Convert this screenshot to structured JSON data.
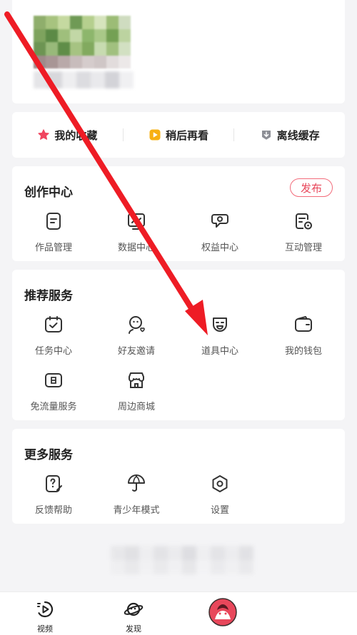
{
  "quick_actions": [
    {
      "label": "我的收藏",
      "icon": "star-icon"
    },
    {
      "label": "稍后再看",
      "icon": "play-later-icon"
    },
    {
      "label": "离线缓存",
      "icon": "download-icon"
    }
  ],
  "creation_center": {
    "title": "创作中心",
    "publish_label": "发布",
    "items": [
      {
        "label": "作品管理",
        "icon": "document-icon"
      },
      {
        "label": "数据中心",
        "icon": "chart-icon"
      },
      {
        "label": "权益中心",
        "icon": "chat-badge-icon"
      },
      {
        "label": "互动管理",
        "icon": "message-gear-icon"
      }
    ]
  },
  "recommended_services": {
    "title": "推荐服务",
    "items": [
      {
        "label": "任务中心",
        "icon": "calendar-check-icon"
      },
      {
        "label": "好友邀请",
        "icon": "friend-heart-icon"
      },
      {
        "label": "道具中心",
        "icon": "mask-icon"
      },
      {
        "label": "我的钱包",
        "icon": "wallet-icon"
      },
      {
        "label": "免流量服务",
        "icon": "sim-card-icon"
      },
      {
        "label": "周边商城",
        "icon": "shop-icon"
      }
    ]
  },
  "more_services": {
    "title": "更多服务",
    "items": [
      {
        "label": "反馈帮助",
        "icon": "help-edit-icon"
      },
      {
        "label": "青少年模式",
        "icon": "umbrella-icon"
      },
      {
        "label": "设置",
        "icon": "settings-hexagon-icon"
      }
    ]
  },
  "tabbar": {
    "items": [
      {
        "label": "视频",
        "icon": "video-tab-icon"
      },
      {
        "label": "发现",
        "icon": "planet-tab-icon"
      },
      {
        "label": "",
        "icon": "avatar-tab-icon"
      }
    ]
  },
  "colors": {
    "accent": "#e8475b",
    "star": "#f0455f",
    "play_later": "#f7b012",
    "arrow": "#ee1c25"
  }
}
